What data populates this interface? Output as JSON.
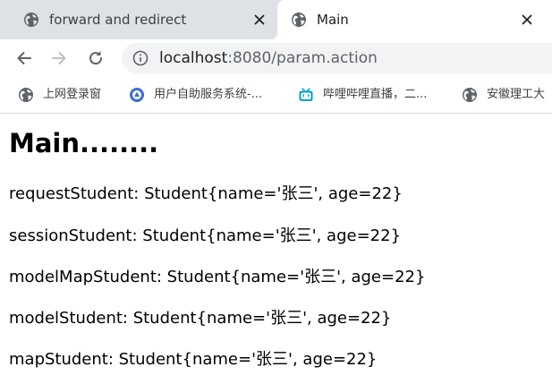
{
  "tabs": [
    {
      "title": "forward and redirect",
      "active": false,
      "icon": "globe-icon"
    },
    {
      "title": "Main",
      "active": true,
      "icon": "globe-icon"
    }
  ],
  "toolbar": {
    "url_host": "localhost",
    "url_rest": ":8080/param.action"
  },
  "bookmarks": [
    {
      "label": "上网登录窗",
      "icon": "globe-icon"
    },
    {
      "label": "用户自助服务系统-...",
      "icon": "portal-icon"
    },
    {
      "label": "哔哩哔哩直播，二...",
      "icon": "bilibili-icon"
    },
    {
      "label": "安徽理工大",
      "icon": "globe-icon"
    }
  ],
  "page": {
    "heading": "Main........",
    "lines": [
      "requestStudent: Student{name='张三', age=22}",
      "sessionStudent: Student{name='张三', age=22}",
      "modelMapStudent: Student{name='张三', age=22}",
      "modelStudent: Student{name='张三', age=22}",
      "mapStudent: Student{name='张三', age=22}"
    ]
  },
  "colors": {
    "tabstrip_bg": "#dee1e6",
    "omnibox_bg": "#f1f3f4",
    "icon_gray": "#5f6368",
    "bilibili_blue": "#00a1d6",
    "portal_blue": "#3b6fd1"
  }
}
